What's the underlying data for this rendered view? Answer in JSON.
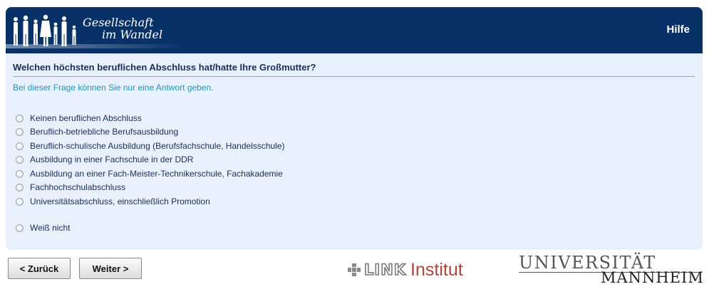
{
  "header": {
    "brand_line1": "Gesellschaft",
    "brand_line2": "im Wandel",
    "help_label": "Hilfe"
  },
  "question": {
    "text": "Welchen höchsten beruflichen Abschluss hat/hatte Ihre Großmutter?",
    "instruction": "Bei dieser Frage können Sie nur eine Antwort geben."
  },
  "options": [
    "Keinen beruflichen Abschluss",
    "Beruflich-betriebliche Berufsausbildung",
    "Beruflich-schulische Ausbildung (Berufsfachschule, Handelsschule)",
    "Ausbildung in einer Fachschule in der DDR",
    "Ausbildung an einer Fach-Meister-Technikerschule, Fachakademie",
    "Fachhochschulabschluss",
    "Universitätsabschluss, einschließlich Promotion",
    "Weiß nicht"
  ],
  "nav": {
    "back_label": "< Zurück",
    "next_label": "Weiter >"
  },
  "footer": {
    "link_word": "LINK",
    "institut_word": "Institut",
    "uni_top": "UNIVERSITÄT",
    "uni_bottom": "MANNHEIM"
  },
  "colors": {
    "header_bg": "#083267",
    "panel_bg": "#e8f0fb",
    "question_text": "#1a2e5a",
    "instruction_text": "#1e96b8",
    "link_red": "#b0443f"
  }
}
